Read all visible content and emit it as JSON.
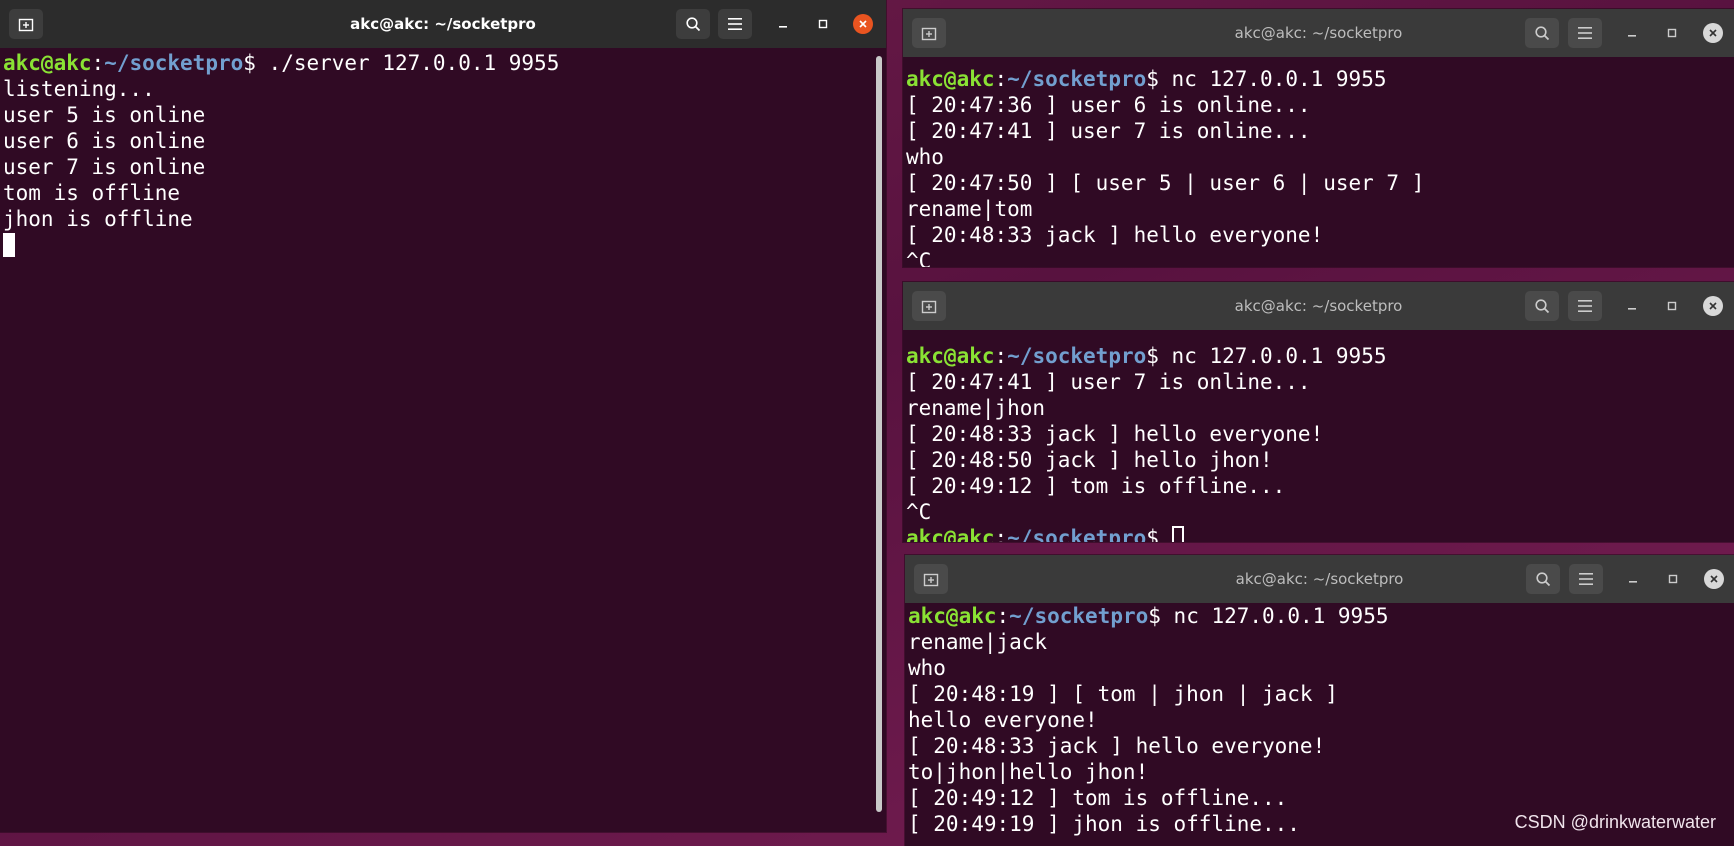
{
  "prompt": {
    "user": "akc@akc",
    "sep": ":",
    "path": "~/socketpro",
    "dollar": "$ "
  },
  "windows": [
    {
      "id": "server",
      "title": "akc@akc: ~/socketpro",
      "active": true,
      "lines": [
        {
          "type": "prompt",
          "cmd": "./server 127.0.0.1 9955"
        },
        {
          "type": "text",
          "text": "listening..."
        },
        {
          "type": "text",
          "text": "user 5 is online"
        },
        {
          "type": "text",
          "text": "user 6 is online"
        },
        {
          "type": "text",
          "text": "user 7 is online"
        },
        {
          "type": "text",
          "text": "tom is offline"
        },
        {
          "type": "text",
          "text": "jhon is offline"
        },
        {
          "type": "cursor"
        }
      ]
    },
    {
      "id": "client-tom",
      "title": "akc@akc: ~/socketpro",
      "active": false,
      "lines": [
        {
          "type": "prompt",
          "cmd": "nc 127.0.0.1 9955"
        },
        {
          "type": "text",
          "text": "[ 20:47:36 ] user 6 is online..."
        },
        {
          "type": "text",
          "text": "[ 20:47:41 ] user 7 is online..."
        },
        {
          "type": "text",
          "text": "who"
        },
        {
          "type": "text",
          "text": "[ 20:47:50 ] [ user 5 | user 6 | user 7 ]"
        },
        {
          "type": "text",
          "text": "rename|tom"
        },
        {
          "type": "text",
          "text": "[ 20:48:33 jack ] hello everyone!"
        },
        {
          "type": "text",
          "text": "^C"
        }
      ]
    },
    {
      "id": "client-jhon",
      "title": "akc@akc: ~/socketpro",
      "active": false,
      "lines": [
        {
          "type": "prompt",
          "cmd": "nc 127.0.0.1 9955"
        },
        {
          "type": "text",
          "text": "[ 20:47:41 ] user 7 is online..."
        },
        {
          "type": "text",
          "text": "rename|jhon"
        },
        {
          "type": "text",
          "text": "[ 20:48:33 jack ] hello everyone!"
        },
        {
          "type": "text",
          "text": "[ 20:48:50 jack ] hello jhon!"
        },
        {
          "type": "text",
          "text": "[ 20:49:12 ] tom is offline..."
        },
        {
          "type": "text",
          "text": "^C"
        },
        {
          "type": "prompt",
          "cmd": "",
          "cursor": "outline"
        }
      ]
    },
    {
      "id": "client-jack",
      "title": "akc@akc: ~/socketpro",
      "active": false,
      "lines": [
        {
          "type": "prompt",
          "cmd": "nc 127.0.0.1 9955"
        },
        {
          "type": "text",
          "text": "rename|jack"
        },
        {
          "type": "text",
          "text": "who"
        },
        {
          "type": "text",
          "text": "[ 20:48:19 ] [ tom | jhon | jack ]"
        },
        {
          "type": "text",
          "text": "hello everyone!"
        },
        {
          "type": "text",
          "text": "[ 20:48:33 jack ] hello everyone!"
        },
        {
          "type": "text",
          "text": "to|jhon|hello jhon!"
        },
        {
          "type": "text",
          "text": "[ 20:49:12 ] tom is offline..."
        },
        {
          "type": "text",
          "text": "[ 20:49:19 ] jhon is offline..."
        }
      ]
    }
  ],
  "icons": {
    "new_tab": "new-tab-icon",
    "search": "search-icon",
    "menu": "hamburger-menu-icon",
    "minimize": "minimize-icon",
    "maximize": "maximize-icon",
    "close": "close-icon"
  },
  "colors": {
    "terminal_bg": "#300a24",
    "prompt_user": "#8ae234",
    "prompt_path": "#729fcf",
    "close_active": "#e95420"
  },
  "watermark": "CSDN @drinkwaterwater"
}
